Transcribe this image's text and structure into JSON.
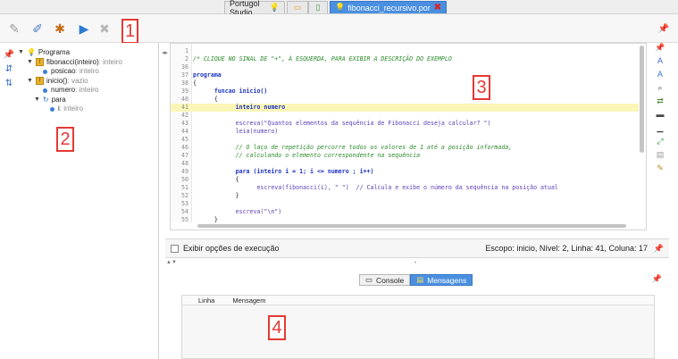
{
  "tabs": {
    "home_label": "Portugol Studio",
    "file_label": "fibonacci_recursivo.por"
  },
  "callouts": [
    "1",
    "2",
    "3",
    "4"
  ],
  "tree": {
    "root": "Programa",
    "fib_name": "fibonacci(inteiro)",
    "fib_type": " : inteiro",
    "posicao_name": "posicao",
    "posicao_type": " : inteiro",
    "inicio_name": "inicio()",
    "inicio_type": " : vazio",
    "numero_name": "numero",
    "numero_type": " : inteiro",
    "para_name": "para",
    "i_name": "i",
    "i_type": " : inteiro"
  },
  "editor": {
    "lines": [
      {
        "n": "1",
        "code": ""
      },
      {
        "n": "2",
        "code": "/* CLIQUE NO SINAL DE \"+\", À ESQUERDA, PARA EXIBIR A DESCRIÇÃO DO EXEMPLO"
      },
      {
        "n": "36",
        "code": ""
      },
      {
        "n": "37",
        "code": "programa"
      },
      {
        "n": "38",
        "code": "{"
      },
      {
        "n": "39",
        "code": "      funcao inicio()"
      },
      {
        "n": "40",
        "code": "      {"
      },
      {
        "n": "41",
        "code": "            inteiro numero"
      },
      {
        "n": "42",
        "code": ""
      },
      {
        "n": "43",
        "code": "            escreva(\"Quantos elementos da sequência de Fibonacci deseja calcular? \")"
      },
      {
        "n": "44",
        "code": "            leia(numero)"
      },
      {
        "n": "45",
        "code": ""
      },
      {
        "n": "46",
        "code": "            // O laço de repetição percorre todos os valores de 1 até a posição informada,"
      },
      {
        "n": "47",
        "code": "            // calculando o elemento correspondente na sequência"
      },
      {
        "n": "48",
        "code": ""
      },
      {
        "n": "49",
        "code": "            para (inteiro i = 1; i <= numero ; i++)"
      },
      {
        "n": "50",
        "code": "            {"
      },
      {
        "n": "51",
        "code": "                  escreva(fibonacci(i), \" \")  // Calcula e exibe o número da sequência na posição atual"
      },
      {
        "n": "52",
        "code": "            }"
      },
      {
        "n": "53",
        "code": ""
      },
      {
        "n": "54",
        "code": "            escreva(\"\\n\")"
      },
      {
        "n": "55",
        "code": "      }"
      }
    ]
  },
  "status": {
    "exec_options_label": "Exibir opções de execução",
    "scope_text": "Escopo: inicio, Nível: 2, Linha: 41, Coluna: 17"
  },
  "console": {
    "console_tab": "Console",
    "messages_tab": "Mensagens",
    "col_line": "Linha",
    "col_message": "Mensagem"
  },
  "colors": {
    "accent": "#4a8fe0",
    "callout": "#e53935",
    "highlight": "#fbf6b8"
  }
}
